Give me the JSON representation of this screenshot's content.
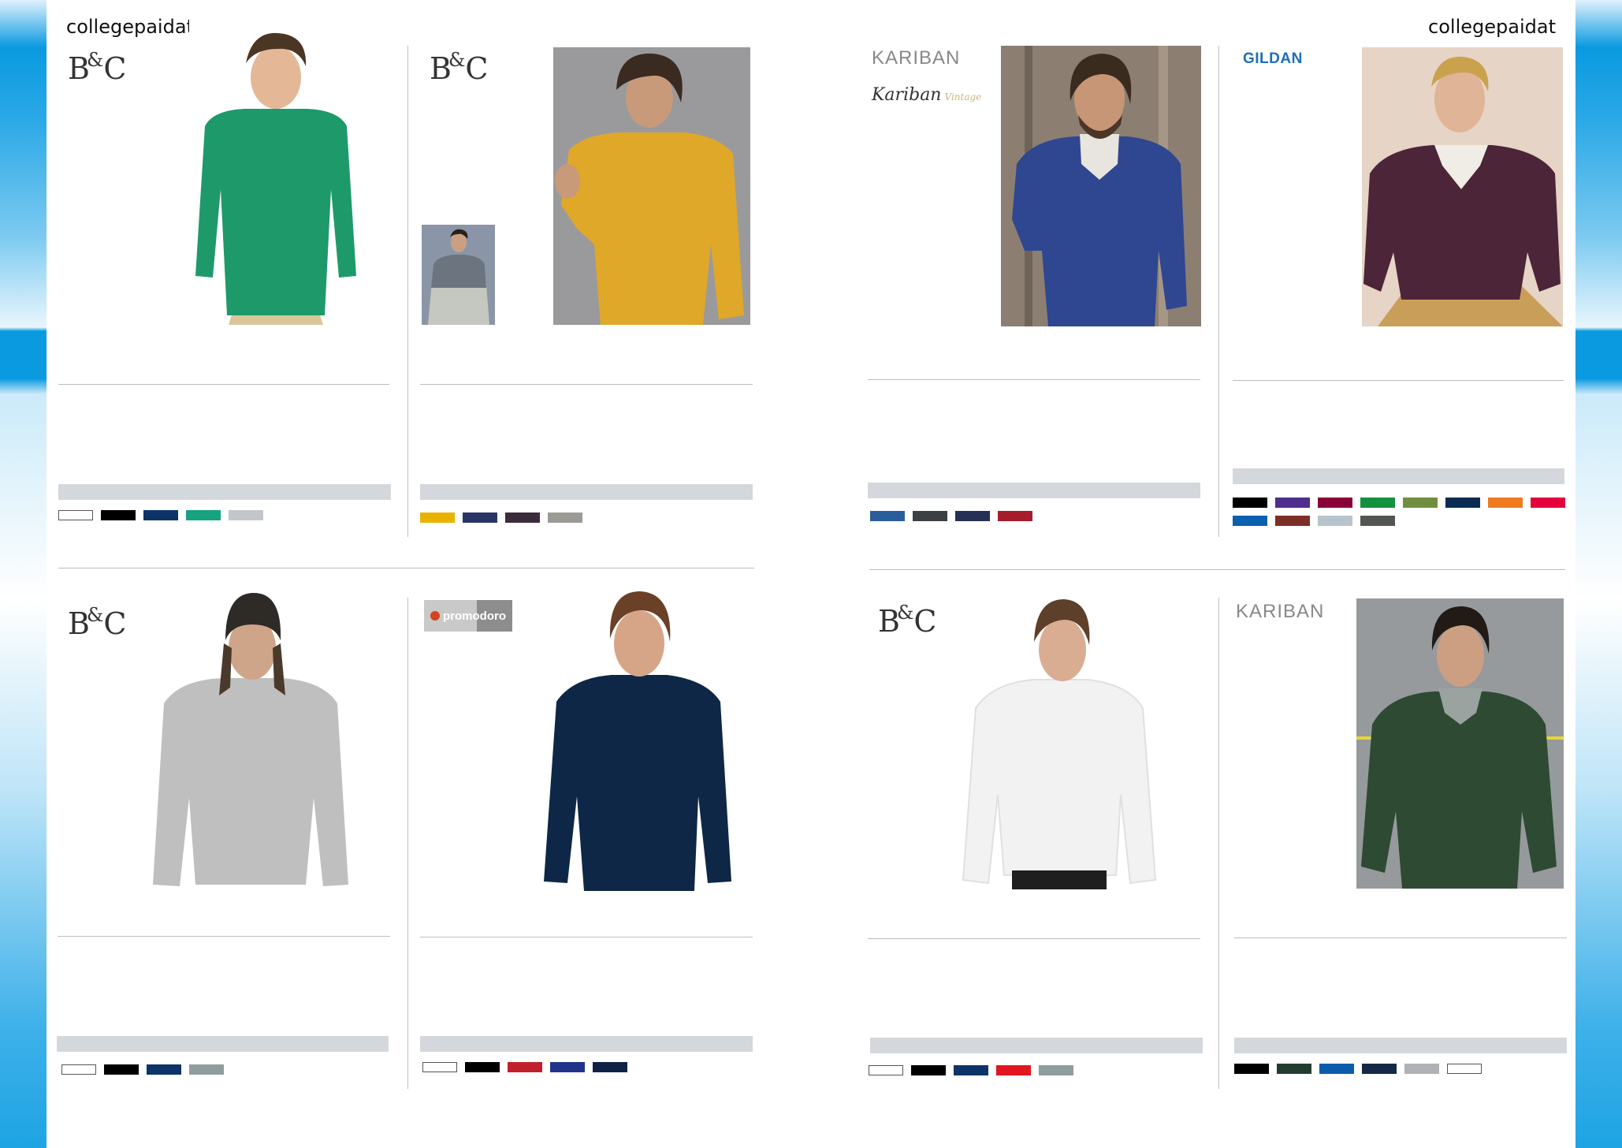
{
  "header": {
    "left_title": "collegepaidat",
    "right_title": "collegepaidat"
  },
  "brands": {
    "bc": "B&C",
    "kariban": "KARIBAN",
    "kariban_script": "Kariban",
    "kariban_script_sub": "Vintage",
    "gildan": "GILDAN",
    "promodoro": "promodoro"
  },
  "products": [
    {
      "brand": "bc",
      "swatches": [
        "#ffffff",
        "#000000",
        "#0c3469",
        "#17a37f",
        "#c3c6c8"
      ]
    },
    {
      "brand": "bc",
      "swatches": [
        "#e9b200",
        "#293566",
        "#3b2c3b",
        "#9b9a94"
      ]
    },
    {
      "brand": "kariban",
      "swatches": [
        "#295d9c",
        "#3c4043",
        "#263055",
        "#a71c2c"
      ]
    },
    {
      "brand": "gildan",
      "swatches": [
        "#000000",
        "#4e2e8d",
        "#8a0039",
        "#14913e",
        "#6f8f3f",
        "#0a2c52",
        "#ef7b21",
        "#e4003c",
        "#0b60ad",
        "#7b2f26",
        "#b7c4cc",
        "#525652"
      ]
    },
    {
      "brand": "bc",
      "swatches": [
        "#ffffff",
        "#000000",
        "#0c3469",
        "#909d9d"
      ]
    },
    {
      "brand": "promodoro",
      "swatches": [
        "#ffffff",
        "#000000",
        "#c0202b",
        "#22338c",
        "#0e2245"
      ]
    },
    {
      "brand": "bc",
      "swatches": [
        "#ffffff",
        "#000000",
        "#0c3469",
        "#e1161f",
        "#909d9d"
      ]
    },
    {
      "brand": "kariban",
      "swatches": [
        "#000000",
        "#223d30",
        "#0b5cad",
        "#152848",
        "#b0b1b4",
        "#ffffff"
      ]
    }
  ]
}
